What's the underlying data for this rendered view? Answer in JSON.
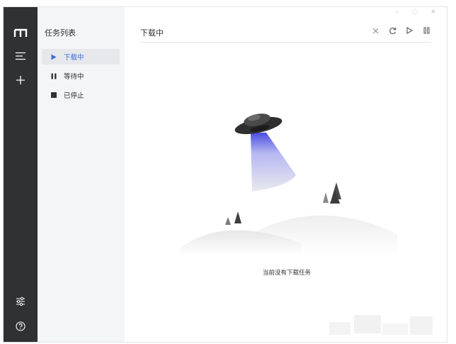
{
  "sidebar": {
    "items": [
      {
        "name": "logo-icon"
      },
      {
        "name": "menu-icon"
      },
      {
        "name": "plus-icon"
      },
      {
        "name": "settings-sliders-icon"
      },
      {
        "name": "help-icon"
      }
    ]
  },
  "tasklist": {
    "title": "任务列表",
    "items": [
      {
        "label": "下载中",
        "icon": "play-icon",
        "active": true
      },
      {
        "label": "等待中",
        "icon": "pause-icon",
        "active": false
      },
      {
        "label": "已停止",
        "icon": "stop-icon",
        "active": false
      }
    ]
  },
  "window": {
    "minimize": "–",
    "maximize": "◌",
    "close": "×"
  },
  "main": {
    "title": "下载中",
    "toolbar": [
      "delete-icon",
      "refresh-icon",
      "resume-icon",
      "pause-all-icon"
    ],
    "empty_text": "当前没有下载任务"
  },
  "colors": {
    "rail": "#303133",
    "panel": "#f4f5f7",
    "accent": "#3d6dde"
  }
}
